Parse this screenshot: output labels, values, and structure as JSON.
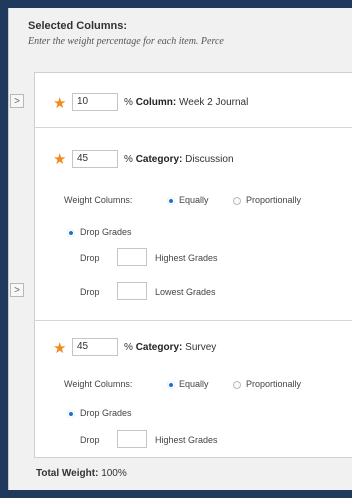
{
  "header": {
    "title": "Selected Columns:",
    "instruction": "Enter the weight percentage for each item. Perce"
  },
  "items": [
    {
      "weight": "10",
      "unit": "%",
      "kind": "Column:",
      "name": "Week 2 Journal"
    },
    {
      "weight": "45",
      "unit": "%",
      "kind": "Category:",
      "name": "Discussion",
      "weight_columns_label": "Weight Columns:",
      "equally": "Equally",
      "proportionally": "Proportionally",
      "drop_grades_label": "Drop Grades",
      "drop_rows": [
        {
          "prefix": "Drop",
          "value": "",
          "suffix": "Highest Grades"
        },
        {
          "prefix": "Drop",
          "value": "",
          "suffix": "Lowest Grades"
        }
      ]
    },
    {
      "weight": "45",
      "unit": "%",
      "kind": "Category:",
      "name": "Survey",
      "weight_columns_label": "Weight Columns:",
      "equally": "Equally",
      "proportionally": "Proportionally",
      "drop_grades_label": "Drop Grades",
      "drop_rows": [
        {
          "prefix": "Drop",
          "value": "",
          "suffix": "Highest Grades"
        }
      ]
    }
  ],
  "expander_glyph": ">",
  "required_glyph": "★",
  "total": {
    "label": "Total Weight:",
    "value": "100%"
  },
  "colors": {
    "accent": "#2c7fd6",
    "required": "#f28a1c",
    "frame": "#1f3a5c"
  }
}
